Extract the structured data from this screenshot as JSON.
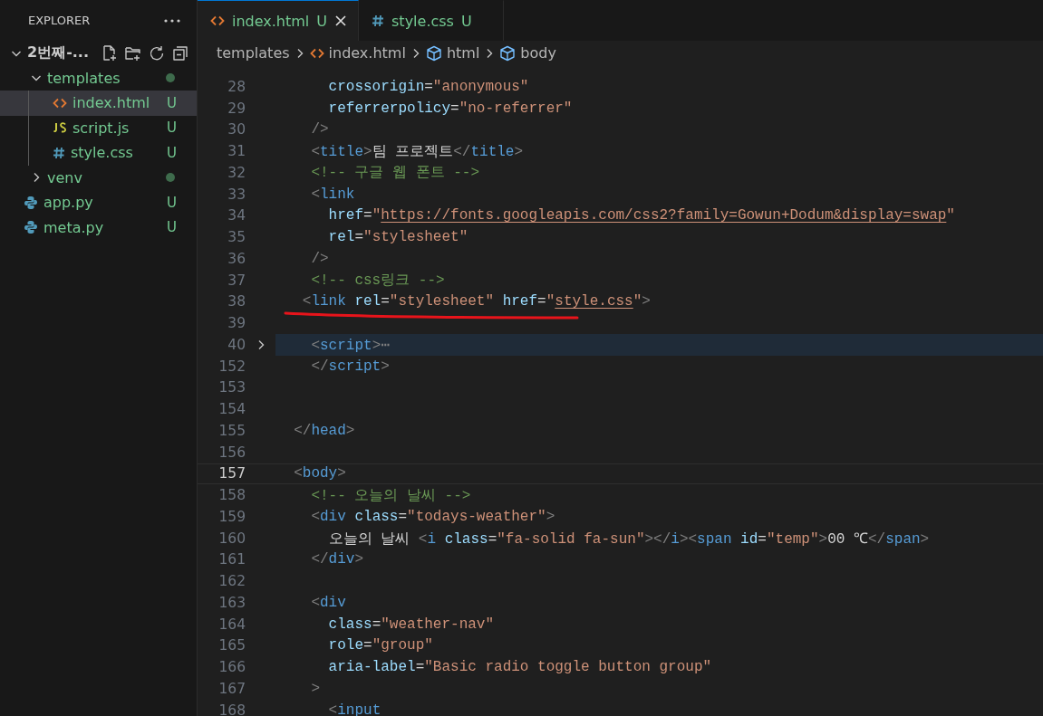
{
  "explorer": {
    "title": "EXPLORER",
    "root": {
      "label": "2번째-...",
      "expanded": true,
      "children": [
        {
          "label": "templates",
          "kind": "folder",
          "expanded": true,
          "selected": false,
          "dot": true,
          "children": [
            {
              "label": "index.html",
              "kind": "html",
              "selected": true,
              "badge": "U"
            },
            {
              "label": "script.js",
              "kind": "js",
              "selected": false,
              "badge": "U"
            },
            {
              "label": "style.css",
              "kind": "css",
              "selected": false,
              "badge": "U"
            }
          ]
        },
        {
          "label": "venv",
          "kind": "folder",
          "expanded": false,
          "selected": false,
          "dot": true
        },
        {
          "label": "app.py",
          "kind": "python",
          "selected": false,
          "badge": "U"
        },
        {
          "label": "meta.py",
          "kind": "python",
          "selected": false,
          "badge": "U"
        }
      ]
    }
  },
  "tabs": [
    {
      "label": "index.html",
      "kind": "html",
      "badge": "U",
      "selected": true
    },
    {
      "label": "style.css",
      "kind": "css",
      "badge": "U",
      "selected": false
    }
  ],
  "breadcrumbs": [
    {
      "label": "templates",
      "kind": "folder"
    },
    {
      "label": "index.html",
      "kind": "html"
    },
    {
      "label": "html",
      "kind": "element"
    },
    {
      "label": "body",
      "kind": "element"
    }
  ],
  "lines": [
    {
      "number": "28",
      "kind": "plain",
      "tokens": [
        {
          "kind": "attr",
          "text": "      crossorigin"
        },
        {
          "kind": "plain",
          "text": "="
        },
        {
          "kind": "str",
          "text": "\"anonymous\""
        }
      ]
    },
    {
      "number": "29",
      "kind": "plain",
      "tokens": [
        {
          "kind": "attr",
          "text": "      referrerpolicy"
        },
        {
          "kind": "plain",
          "text": "="
        },
        {
          "kind": "str",
          "text": "\"no-referrer\""
        }
      ]
    },
    {
      "number": "30",
      "kind": "plain",
      "tokens": [
        {
          "kind": "punct",
          "text": "    />"
        }
      ]
    },
    {
      "number": "31",
      "kind": "plain",
      "tokens": [
        {
          "kind": "punct",
          "text": "    <"
        },
        {
          "kind": "tag",
          "text": "title"
        },
        {
          "kind": "punct",
          "text": ">"
        },
        {
          "kind": "plain",
          "text": "팀 프로젝트"
        },
        {
          "kind": "punct",
          "text": "</"
        },
        {
          "kind": "tag",
          "text": "title"
        },
        {
          "kind": "punct",
          "text": ">"
        }
      ]
    },
    {
      "number": "32",
      "kind": "plain",
      "tokens": [
        {
          "kind": "comment",
          "text": "    <!-- 구글 웹 폰트 -->"
        }
      ]
    },
    {
      "number": "33",
      "kind": "plain",
      "tokens": [
        {
          "kind": "punct",
          "text": "    <"
        },
        {
          "kind": "tag",
          "text": "link"
        }
      ]
    },
    {
      "number": "34",
      "kind": "plain",
      "tokens": [
        {
          "kind": "attr",
          "text": "      href"
        },
        {
          "kind": "plain",
          "text": "="
        },
        {
          "kind": "str",
          "text": "\""
        },
        {
          "kind": "link",
          "text": "https://fonts.googleapis.com/css2?family=Gowun+Dodum&display=swap"
        },
        {
          "kind": "str",
          "text": "\""
        }
      ]
    },
    {
      "number": "35",
      "kind": "plain",
      "tokens": [
        {
          "kind": "attr",
          "text": "      rel"
        },
        {
          "kind": "plain",
          "text": "="
        },
        {
          "kind": "str",
          "text": "\"stylesheet\""
        }
      ]
    },
    {
      "number": "36",
      "kind": "plain",
      "tokens": [
        {
          "kind": "punct",
          "text": "    />"
        }
      ]
    },
    {
      "number": "37",
      "kind": "plain",
      "tokens": [
        {
          "kind": "comment",
          "text": "    <!-- css링크 -->"
        }
      ]
    },
    {
      "number": "38",
      "kind": "annotated",
      "tokens": [
        {
          "kind": "punct",
          "text": "   <"
        },
        {
          "kind": "tag",
          "text": "link"
        },
        {
          "kind": "attr",
          "text": " rel"
        },
        {
          "kind": "plain",
          "text": "="
        },
        {
          "kind": "str",
          "text": "\"stylesheet\""
        },
        {
          "kind": "attr",
          "text": " href"
        },
        {
          "kind": "plain",
          "text": "="
        },
        {
          "kind": "str",
          "text": "\""
        },
        {
          "kind": "link",
          "text": "style.css"
        },
        {
          "kind": "str",
          "text": "\""
        },
        {
          "kind": "punct",
          "text": ">"
        }
      ]
    },
    {
      "number": "39",
      "kind": "plain"
    },
    {
      "number": "40",
      "kind": "folded",
      "tokens": [
        {
          "kind": "punct",
          "text": "    <"
        },
        {
          "kind": "tag",
          "text": "script"
        },
        {
          "kind": "punct",
          "text": ">"
        },
        {
          "kind": "punct",
          "text": "⋯"
        }
      ]
    },
    {
      "number": "152",
      "kind": "plain",
      "tokens": [
        {
          "kind": "punct",
          "text": "    </"
        },
        {
          "kind": "tag",
          "text": "script"
        },
        {
          "kind": "punct",
          "text": ">"
        }
      ]
    },
    {
      "number": "153",
      "kind": "plain"
    },
    {
      "number": "154",
      "kind": "plain"
    },
    {
      "number": "155",
      "kind": "plain",
      "tokens": [
        {
          "kind": "punct",
          "text": "  </"
        },
        {
          "kind": "tag",
          "text": "head"
        },
        {
          "kind": "punct",
          "text": ">"
        }
      ]
    },
    {
      "number": "156",
      "kind": "plain"
    },
    {
      "number": "157",
      "kind": "current",
      "tokens": [
        {
          "kind": "punct",
          "text": "  <"
        },
        {
          "kind": "tag",
          "text": "body"
        },
        {
          "kind": "punct",
          "text": ">"
        }
      ]
    },
    {
      "number": "158",
      "kind": "plain",
      "tokens": [
        {
          "kind": "comment",
          "text": "    <!-- 오늘의 날씨 -->"
        }
      ]
    },
    {
      "number": "159",
      "kind": "plain",
      "tokens": [
        {
          "kind": "punct",
          "text": "    <"
        },
        {
          "kind": "tag",
          "text": "div"
        },
        {
          "kind": "attr",
          "text": " class"
        },
        {
          "kind": "plain",
          "text": "="
        },
        {
          "kind": "str",
          "text": "\"todays-weather\""
        },
        {
          "kind": "punct",
          "text": ">"
        }
      ]
    },
    {
      "number": "160",
      "kind": "plain",
      "tokens": [
        {
          "kind": "plain",
          "text": "      오늘의 날씨 "
        },
        {
          "kind": "punct",
          "text": "<"
        },
        {
          "kind": "tag",
          "text": "i"
        },
        {
          "kind": "attr",
          "text": " class"
        },
        {
          "kind": "plain",
          "text": "="
        },
        {
          "kind": "str",
          "text": "\"fa-solid fa-sun\""
        },
        {
          "kind": "punct",
          "text": "></"
        },
        {
          "kind": "tag",
          "text": "i"
        },
        {
          "kind": "punct",
          "text": "><"
        },
        {
          "kind": "tag",
          "text": "span"
        },
        {
          "kind": "attr",
          "text": " id"
        },
        {
          "kind": "plain",
          "text": "="
        },
        {
          "kind": "str",
          "text": "\"temp\""
        },
        {
          "kind": "punct",
          "text": ">"
        },
        {
          "kind": "plain",
          "text": "00 ℃"
        },
        {
          "kind": "punct",
          "text": "</"
        },
        {
          "kind": "tag",
          "text": "span"
        },
        {
          "kind": "punct",
          "text": ">"
        }
      ]
    },
    {
      "number": "161",
      "kind": "plain",
      "tokens": [
        {
          "kind": "punct",
          "text": "    </"
        },
        {
          "kind": "tag",
          "text": "div"
        },
        {
          "kind": "punct",
          "text": ">"
        }
      ]
    },
    {
      "number": "162",
      "kind": "plain"
    },
    {
      "number": "163",
      "kind": "plain",
      "tokens": [
        {
          "kind": "punct",
          "text": "    <"
        },
        {
          "kind": "tag",
          "text": "div"
        }
      ]
    },
    {
      "number": "164",
      "kind": "plain",
      "tokens": [
        {
          "kind": "attr",
          "text": "      class"
        },
        {
          "kind": "plain",
          "text": "="
        },
        {
          "kind": "str",
          "text": "\"weather-nav\""
        }
      ]
    },
    {
      "number": "165",
      "kind": "plain",
      "tokens": [
        {
          "kind": "attr",
          "text": "      role"
        },
        {
          "kind": "plain",
          "text": "="
        },
        {
          "kind": "str",
          "text": "\"group\""
        }
      ]
    },
    {
      "number": "166",
      "kind": "plain",
      "tokens": [
        {
          "kind": "attr",
          "text": "      aria-label"
        },
        {
          "kind": "plain",
          "text": "="
        },
        {
          "kind": "str",
          "text": "\"Basic radio toggle button group\""
        }
      ]
    },
    {
      "number": "167",
      "kind": "plain",
      "tokens": [
        {
          "kind": "punct",
          "text": "    >"
        }
      ]
    },
    {
      "number": "168",
      "kind": "plain",
      "tokens": [
        {
          "kind": "punct",
          "text": "      <"
        },
        {
          "kind": "tag",
          "text": "input"
        }
      ]
    }
  ]
}
